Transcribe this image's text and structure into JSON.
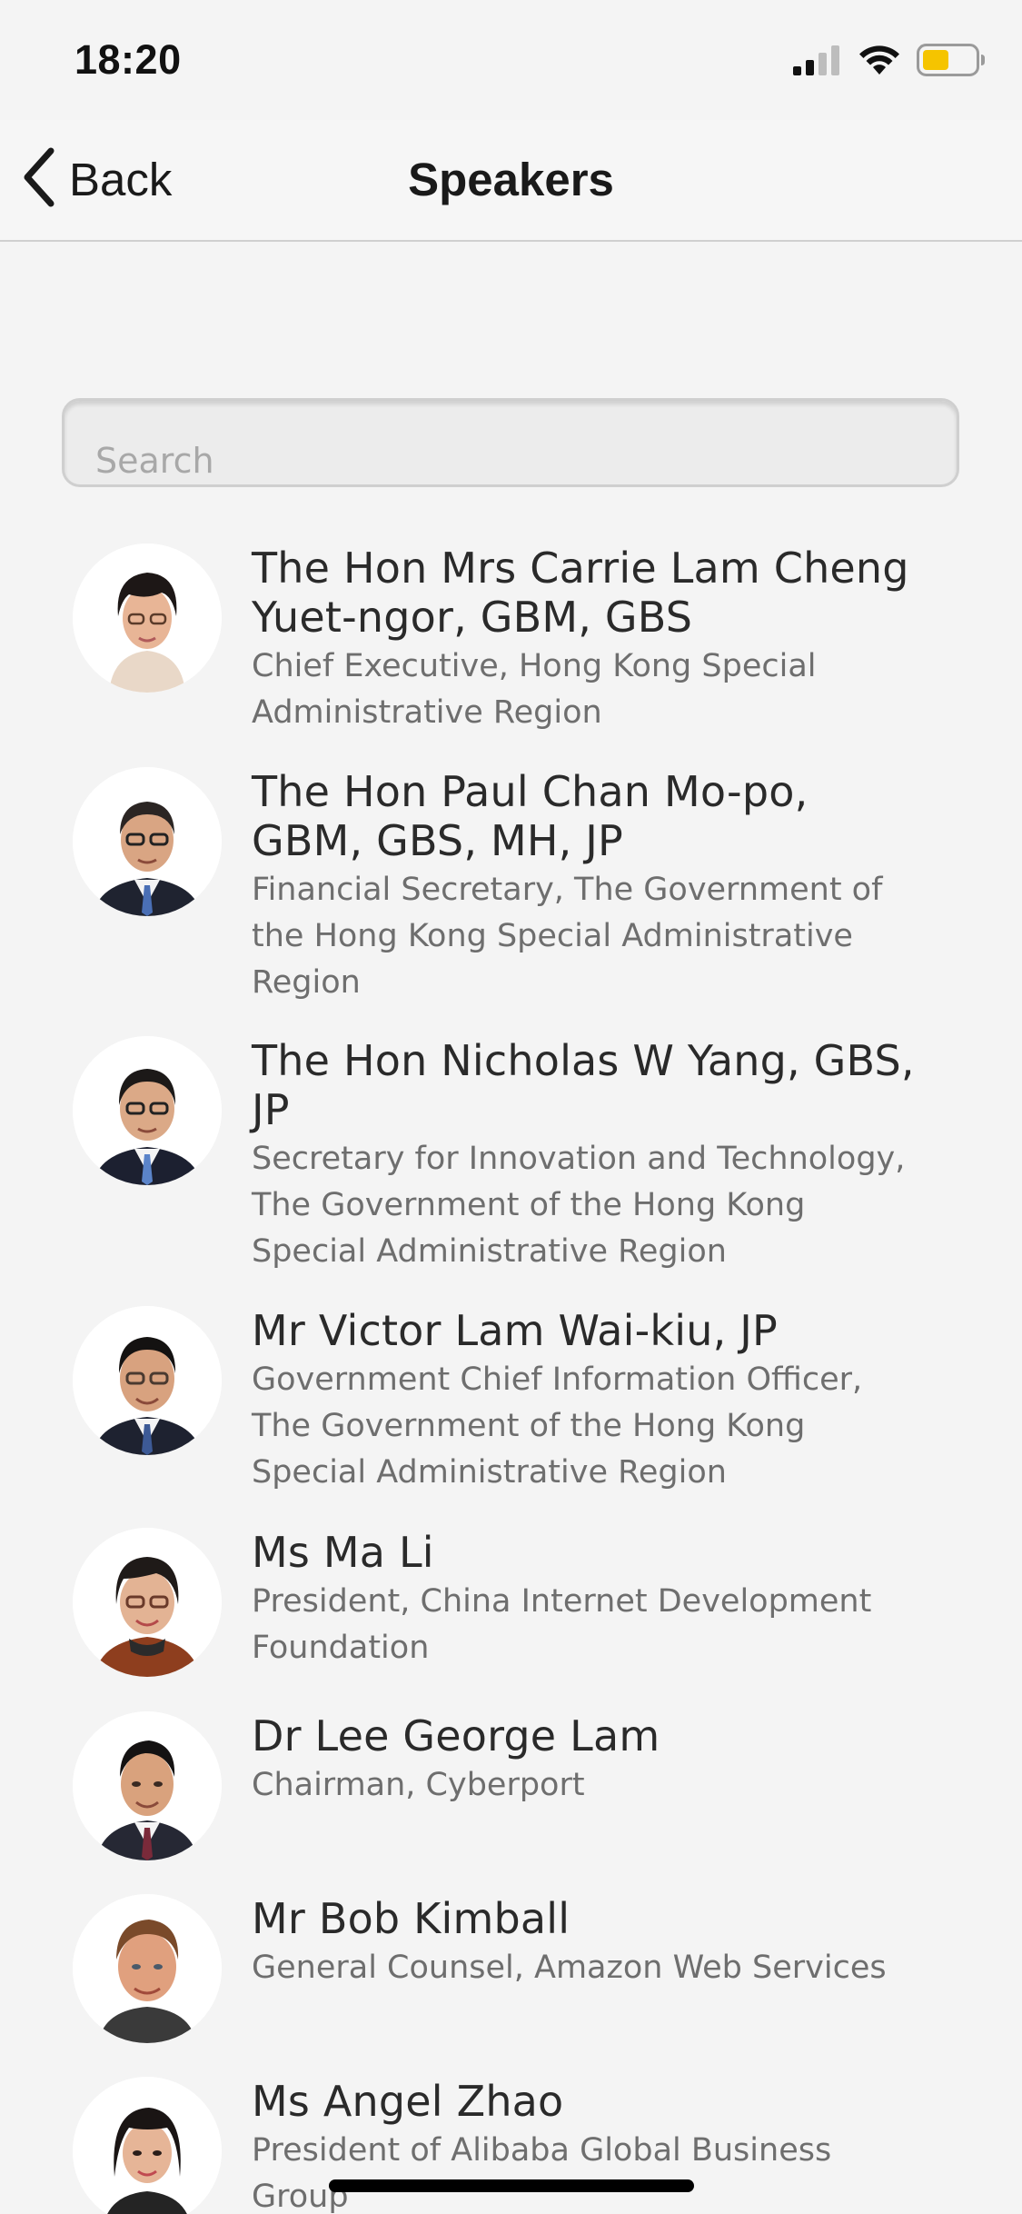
{
  "status_bar": {
    "time": "18:20",
    "icons": [
      "cellular-signal-icon",
      "wifi-icon",
      "battery-icon"
    ],
    "battery_color": "#f5c400"
  },
  "nav": {
    "back_label": "Back",
    "title": "Speakers"
  },
  "search": {
    "placeholder": "Search",
    "value": ""
  },
  "speakers": [
    {
      "name": "The Hon Mrs Carrie Lam Cheng Yuet-ngor, GBM, GBS",
      "role": "Chief Executive, Hong Kong Special Administrative Region"
    },
    {
      "name": "The Hon Paul Chan Mo-po, GBM, GBS, MH, JP",
      "role": "Financial Secretary, The Government of the Hong Kong Special Administrative Region"
    },
    {
      "name": "The Hon Nicholas W Yang, GBS, JP",
      "role": "Secretary for Innovation and Technology, The Government of the Hong Kong Special Administrative Region"
    },
    {
      "name": "Mr Victor Lam Wai-kiu, JP",
      "role": "Government Chief Information Officer, The Government of the Hong Kong Special Administrative Region"
    },
    {
      "name": "Ms Ma Li",
      "role": "President, China Internet Development Foundation"
    },
    {
      "name": "Dr Lee George Lam",
      "role": "Chairman, Cyberport"
    },
    {
      "name": "Mr Bob Kimball",
      "role": "General Counsel, Amazon Web Services"
    },
    {
      "name": "Ms Angel Zhao",
      "role": "President of Alibaba Global Business Group"
    }
  ]
}
